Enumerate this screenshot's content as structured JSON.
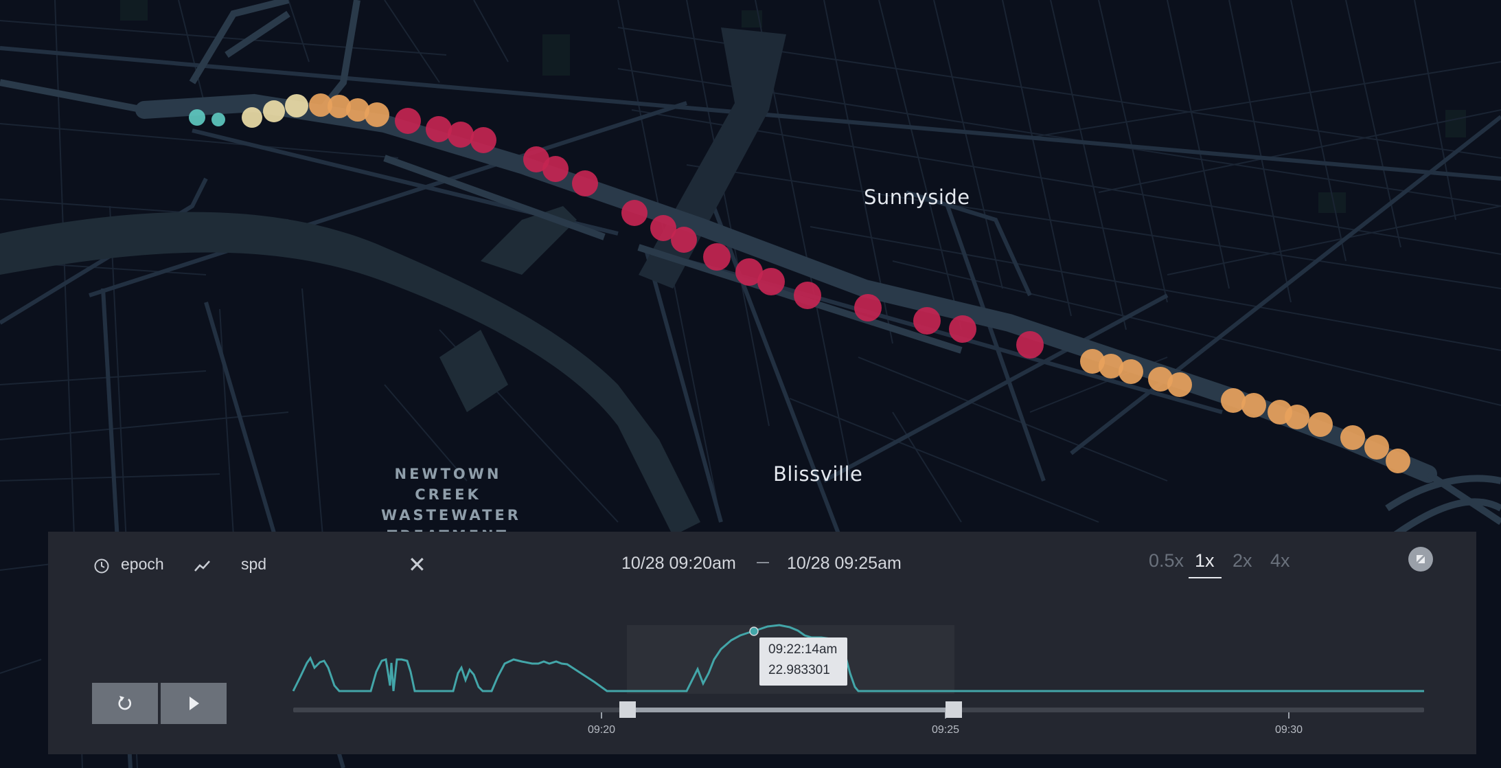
{
  "map": {
    "places": {
      "sunnyside": "Sunnyside",
      "blissville": "Blissville"
    },
    "poi_lines": [
      "NEWTOWN",
      "CREEK",
      "WASTEWATER",
      "TREATMENT"
    ],
    "trip_point_colors": [
      "teal",
      "cream",
      "orange",
      "crimson"
    ],
    "colors": {
      "teal": "#5ec8bf",
      "cream": "#ecdca6",
      "orange": "#e8a25c",
      "crimson": "#c42551"
    }
  },
  "panel": {
    "fields": {
      "time_field": "epoch",
      "value_field": "spd"
    },
    "icons": [
      "clock-icon",
      "trend-line-icon",
      "close-icon",
      "fullscreen-icon",
      "reset-icon",
      "play-icon"
    ],
    "close_label": "✕",
    "range": {
      "start": "10/28 09:20am",
      "end": "10/28 09:25am"
    },
    "speeds": [
      "0.5x",
      "1x",
      "2x",
      "4x"
    ],
    "active_speed": "1x",
    "tooltip": {
      "time": "09:22:14am",
      "value": "22.983301"
    },
    "ticks": [
      "09:20",
      "09:25",
      "09:30"
    ],
    "colors": {
      "panel": "#242730",
      "line": "#43a6a9",
      "track": "#40444d",
      "handle": "#d3d6db"
    }
  }
}
